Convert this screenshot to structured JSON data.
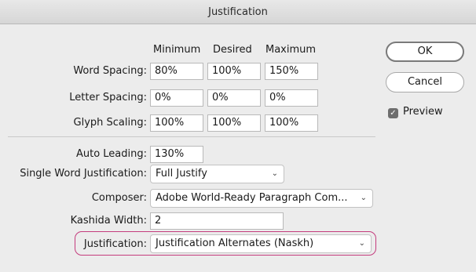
{
  "window": {
    "title": "Justification"
  },
  "spacing": {
    "headers": {
      "minimum": "Minimum",
      "desired": "Desired",
      "maximum": "Maximum"
    },
    "word_spacing": {
      "label": "Word Spacing:",
      "minimum": "80%",
      "desired": "100%",
      "maximum": "150%"
    },
    "letter_spacing": {
      "label": "Letter Spacing:",
      "minimum": "0%",
      "desired": "0%",
      "maximum": "0%"
    },
    "glyph_scaling": {
      "label": "Glyph Scaling:",
      "minimum": "100%",
      "desired": "100%",
      "maximum": "100%"
    }
  },
  "auto_leading": {
    "label": "Auto Leading:",
    "value": "130%"
  },
  "single_word_justification": {
    "label": "Single Word Justification:",
    "value": "Full Justify"
  },
  "composer": {
    "label": "Composer:",
    "value": "Adobe World-Ready Paragraph Com..."
  },
  "kashida_width": {
    "label": "Kashida Width:",
    "value": "2"
  },
  "justification": {
    "label": "Justification:",
    "value": "Justification Alternates (Naskh)"
  },
  "buttons": {
    "ok": "OK",
    "cancel": "Cancel"
  },
  "preview": {
    "label": "Preview",
    "checked": true
  },
  "colors": {
    "highlight": "#c43c7d"
  }
}
